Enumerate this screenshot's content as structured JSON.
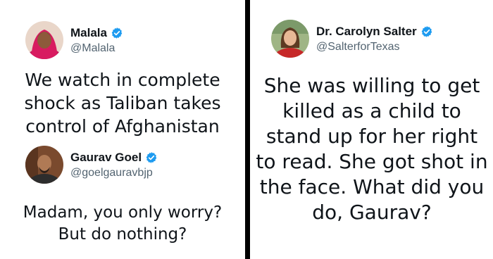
{
  "colors": {
    "verified_badge": "#1d9bf0",
    "handle_text": "#536471",
    "body_text": "#0f1419",
    "divider": "#000000"
  },
  "tweets": [
    {
      "display_name": "Malala",
      "handle": "@Malala",
      "verified": true,
      "avatar_icon": "user-avatar-photo",
      "text": "We watch in complete shock as Taliban takes control of Afghanistan"
    },
    {
      "display_name": "Gaurav Goel",
      "handle": "@goelgauravbjp",
      "verified": true,
      "avatar_icon": "user-avatar-photo",
      "text": "Madam, you only worry? But do nothing?"
    },
    {
      "display_name": "Dr. Carolyn Salter",
      "handle": "@SalterforTexas",
      "verified": true,
      "avatar_icon": "user-avatar-photo",
      "text": "She was willing to get killed as a child to stand up for her right to read. She got shot in the face. What did you do, Gaurav?"
    }
  ]
}
